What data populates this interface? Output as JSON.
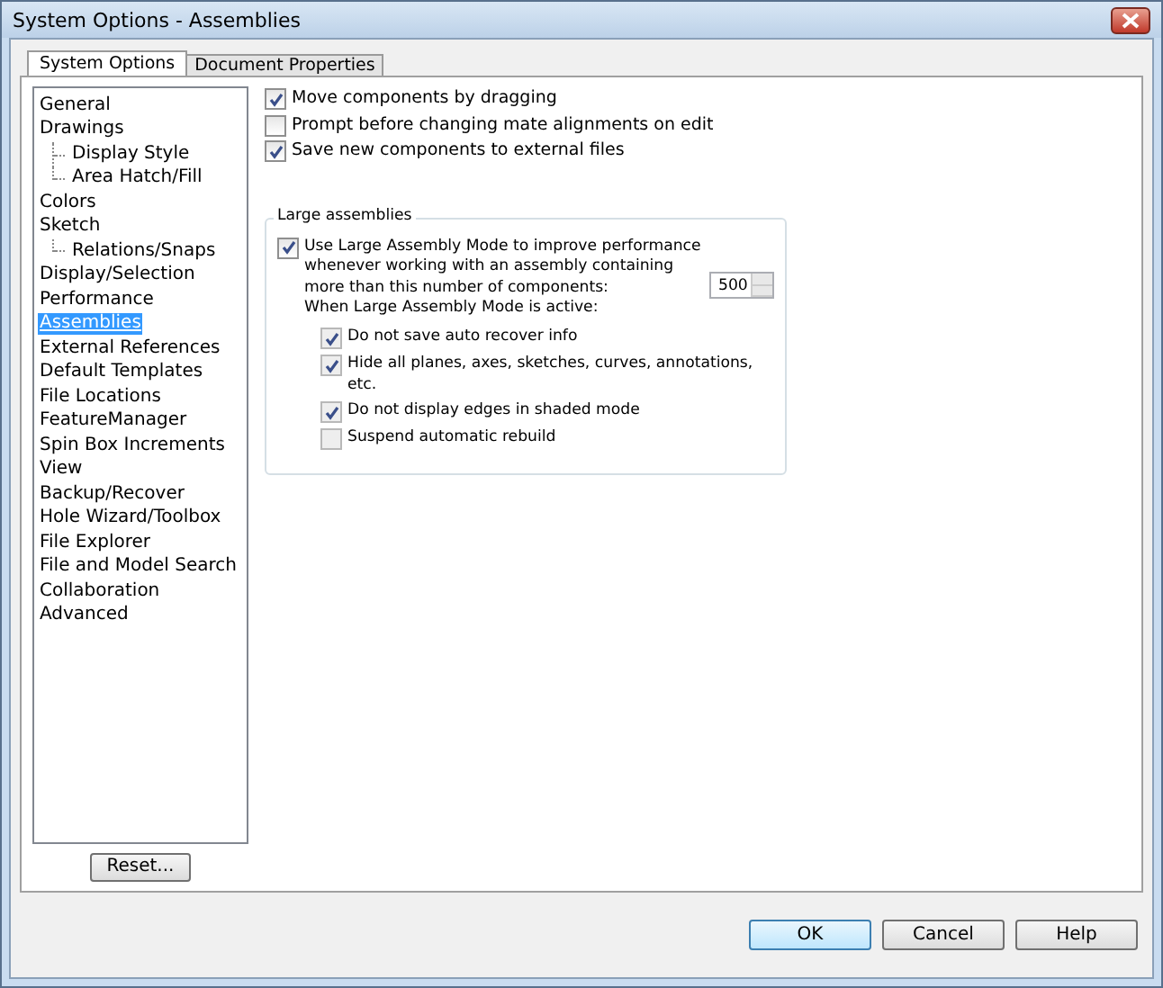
{
  "window": {
    "title": "System Options - Assemblies"
  },
  "tabs": [
    {
      "label": "System Options",
      "selected": true
    },
    {
      "label": "Document Properties",
      "selected": false
    }
  ],
  "sidebar": {
    "items": [
      {
        "label": "General",
        "selected": false
      },
      {
        "label": "Drawings",
        "selected": false,
        "children": [
          {
            "label": "Display Style",
            "selected": false
          },
          {
            "label": "Area Hatch/Fill",
            "selected": false
          }
        ]
      },
      {
        "label": "Colors",
        "selected": false
      },
      {
        "label": "Sketch",
        "selected": false,
        "children": [
          {
            "label": "Relations/Snaps",
            "selected": false
          }
        ]
      },
      {
        "label": "Display/Selection",
        "selected": false
      },
      {
        "label": "Performance",
        "selected": false
      },
      {
        "label": "Assemblies",
        "selected": true
      },
      {
        "label": "External References",
        "selected": false
      },
      {
        "label": "Default Templates",
        "selected": false
      },
      {
        "label": "File Locations",
        "selected": false
      },
      {
        "label": "FeatureManager",
        "selected": false
      },
      {
        "label": "Spin Box Increments",
        "selected": false
      },
      {
        "label": "View",
        "selected": false
      },
      {
        "label": "Backup/Recover",
        "selected": false
      },
      {
        "label": "Hole Wizard/Toolbox",
        "selected": false
      },
      {
        "label": "File Explorer",
        "selected": false
      },
      {
        "label": "File and Model Search",
        "selected": false
      },
      {
        "label": "Collaboration",
        "selected": false
      },
      {
        "label": "Advanced",
        "selected": false
      }
    ],
    "reset_button": "Reset..."
  },
  "options": [
    {
      "label": "Move components by dragging",
      "checked": true
    },
    {
      "label": "Prompt before changing mate alignments on edit",
      "checked": false
    },
    {
      "label": "Save new components to external files",
      "checked": true
    }
  ],
  "large_assemblies": {
    "title": "Large assemblies",
    "mode": {
      "label": "Use Large Assembly Mode to improve performance whenever working with an assembly containing more than this number of components:",
      "checked": true,
      "value": "500"
    },
    "subtitle": "When Large Assembly Mode is active:",
    "options": [
      {
        "label": "Do not save auto recover info",
        "checked": true
      },
      {
        "label": "Hide all planes, axes, sketches, curves, annotations, etc.",
        "checked": true
      },
      {
        "label": "Do not display edges in shaded mode",
        "checked": true
      },
      {
        "label": "Suspend automatic rebuild",
        "checked": false
      }
    ]
  },
  "buttons": [
    "OK",
    "Cancel",
    "Help"
  ]
}
